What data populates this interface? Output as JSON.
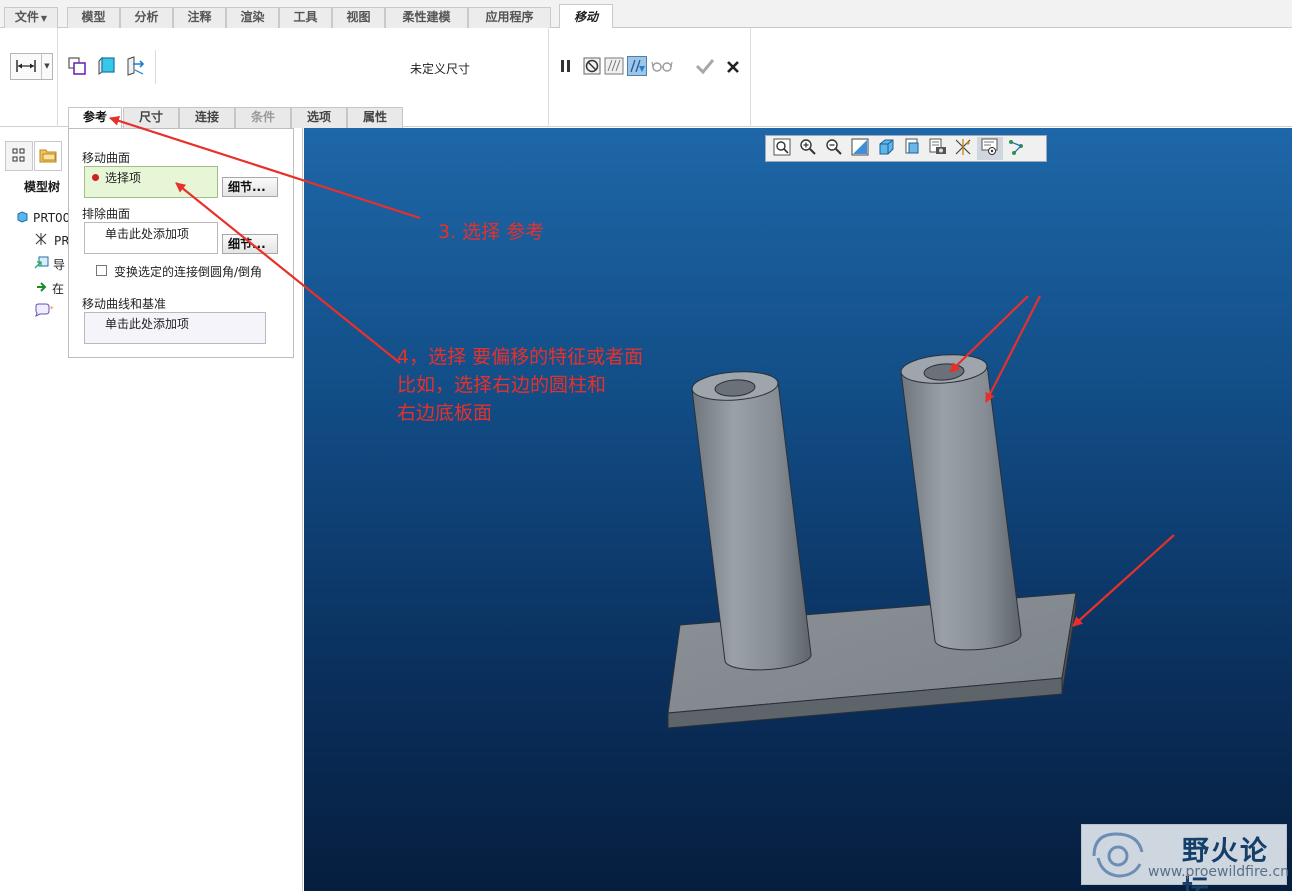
{
  "menu_tabs": [
    {
      "label": "文件"
    },
    {
      "label": "模型"
    },
    {
      "label": "分析"
    },
    {
      "label": "注释"
    },
    {
      "label": "渲染"
    },
    {
      "label": "工具"
    },
    {
      "label": "视图"
    },
    {
      "label": "柔性建模"
    },
    {
      "label": "应用程序"
    },
    {
      "label": "移动",
      "active": true
    }
  ],
  "ribbon": {
    "dimension_status": "未定义尺寸"
  },
  "panel_tabs": [
    {
      "label": "参考",
      "active": true
    },
    {
      "label": "尺寸"
    },
    {
      "label": "连接"
    },
    {
      "label": "条件",
      "disabled": true
    },
    {
      "label": "选项"
    },
    {
      "label": "属性"
    }
  ],
  "navigator": {
    "model_tree_label": "模型树",
    "tree_items": [
      {
        "text": "PRT00",
        "icon": "part-icon"
      },
      {
        "text": "PR",
        "icon": "datum-csys-icon"
      },
      {
        "text": "导",
        "icon": "import-icon"
      },
      {
        "text": "在",
        "icon": "insert-here-arrow-icon"
      },
      {
        "text": "",
        "icon": "annotation-icon"
      }
    ]
  },
  "references_panel": {
    "move_surfaces_label": "移动曲面",
    "move_surfaces_value": "选择项",
    "details_label": "细节...",
    "exclude_surfaces_label": "排除曲面",
    "exclude_surfaces_placeholder": "单击此处添加项",
    "details_label_2": "细节...",
    "checkbox_label": "变换选定的连接倒圆角/倒角",
    "checkbox_checked": false,
    "curves_label": "移动曲线和基准",
    "curves_placeholder": "单击此处添加项"
  },
  "annotations": {
    "step3": "3. 选择  参考",
    "step4_line1": "4，选择  要偏移的特征或者面",
    "step4_line2": " 比如，选择右边的圆柱和",
    "step4_line3": "右边底板面"
  },
  "watermark": {
    "name": "野火论坛",
    "url": "www.proewildfire.cn"
  },
  "colors": {
    "annotation_red": "#e8302a",
    "viewport_top": "#1e67a8",
    "viewport_bottom": "#061e3e",
    "model_grey": "#8a9299",
    "active_collector": "#e8f6d8"
  }
}
